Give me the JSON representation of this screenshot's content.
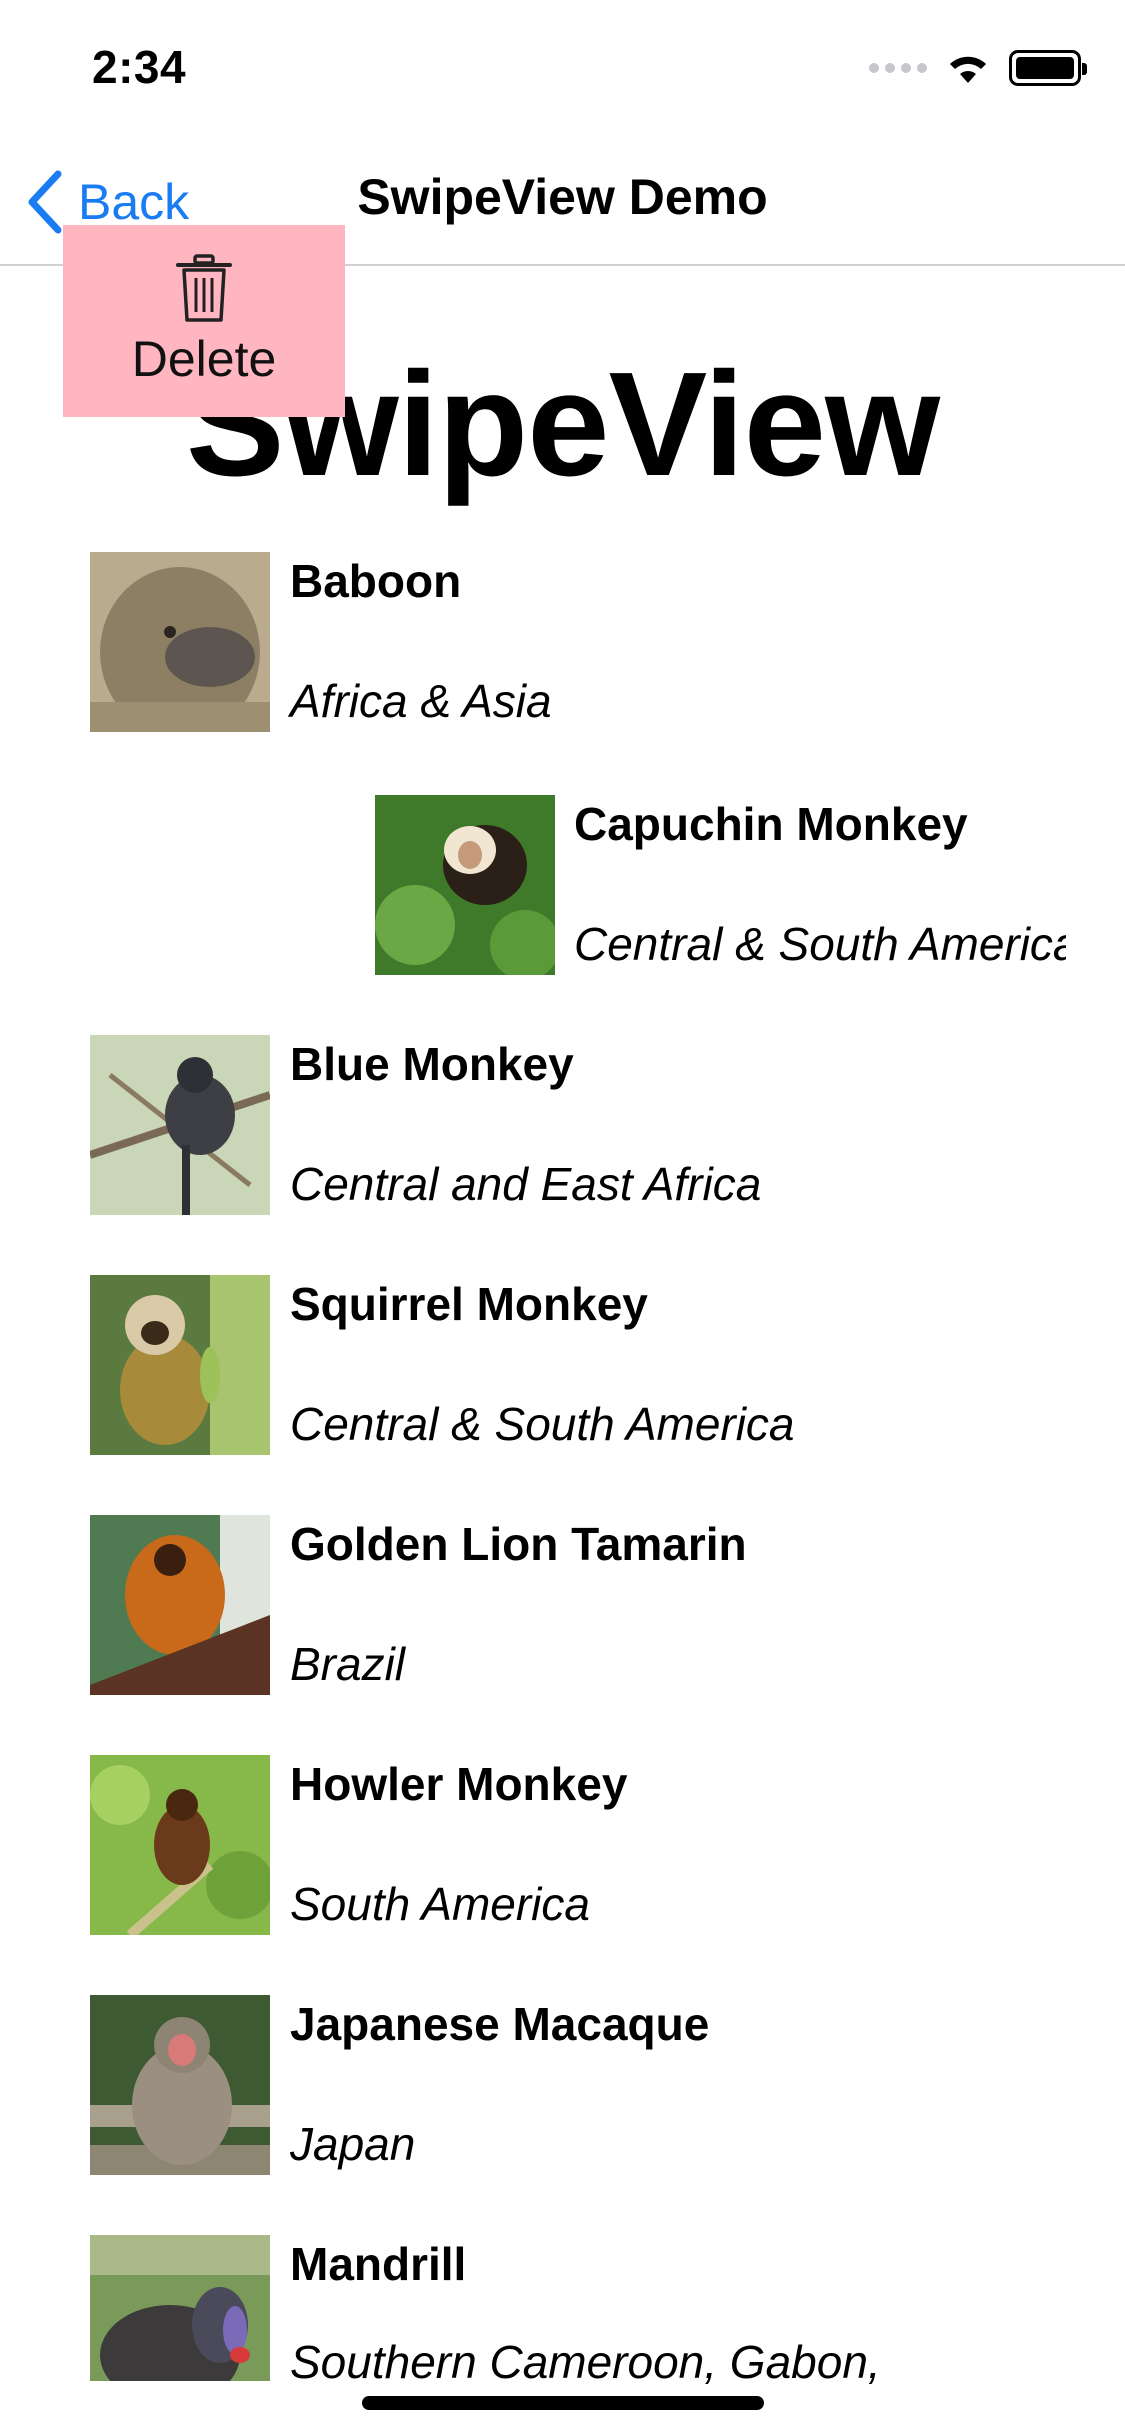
{
  "status_bar": {
    "time": "2:34",
    "icons": [
      "cellular-signal-icon",
      "wifi-icon",
      "battery-icon"
    ]
  },
  "nav": {
    "back_label": "Back",
    "title": "SwipeView Demo",
    "accent_color": "#1a7cf2"
  },
  "page": {
    "title": "SwipeView"
  },
  "swipe_action": {
    "label": "Delete",
    "icon": "trash-icon",
    "background_color": "#ffb6c1"
  },
  "monkeys": [
    {
      "name": "Baboon",
      "location": "Africa & Asia"
    },
    {
      "name": "Capuchin Monkey",
      "location": "Central & South America"
    },
    {
      "name": "Blue Monkey",
      "location": "Central and East Africa"
    },
    {
      "name": "Squirrel Monkey",
      "location": "Central & South America"
    },
    {
      "name": "Golden Lion Tamarin",
      "location": "Brazil"
    },
    {
      "name": "Howler Monkey",
      "location": "South America"
    },
    {
      "name": "Japanese Macaque",
      "location": "Japan"
    },
    {
      "name": "Mandrill",
      "location": "Southern Cameroon, Gabon,"
    }
  ]
}
